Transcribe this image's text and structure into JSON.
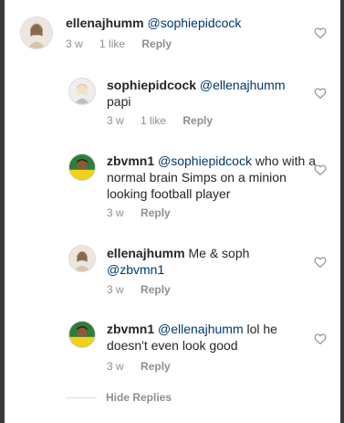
{
  "comments": [
    {
      "username": "ellenajhumm",
      "mention": "@sophiepidcock",
      "body": "",
      "age": "3 w",
      "likes": "1 like",
      "reply": "Reply"
    },
    {
      "username": "sophiepidcock",
      "mention": "@ellenajhumm",
      "body": "papi",
      "age": "3 w",
      "likes": "1 like",
      "reply": "Reply"
    },
    {
      "username": "zbvmn1",
      "mention": "@sophiepidcock",
      "body": " who with a normal brain Simps on a minion looking football player",
      "age": "3 w",
      "reply": "Reply"
    },
    {
      "username": "ellenajhumm",
      "mention": "@zbvmn1",
      "body_before": " Me & soph",
      "age": "3 w",
      "reply": "Reply"
    },
    {
      "username": "zbvmn1",
      "mention": "@ellenajhumm",
      "body": " lol he doesn't even look good",
      "age": "3 w",
      "reply": "Reply"
    }
  ],
  "hide_replies": "Hide Replies",
  "icons": {
    "like": "heart-outline-icon",
    "avatar": "avatar"
  },
  "colors": {
    "mention": "#00376b",
    "meta": "#8e8e8e",
    "text": "#262626"
  }
}
